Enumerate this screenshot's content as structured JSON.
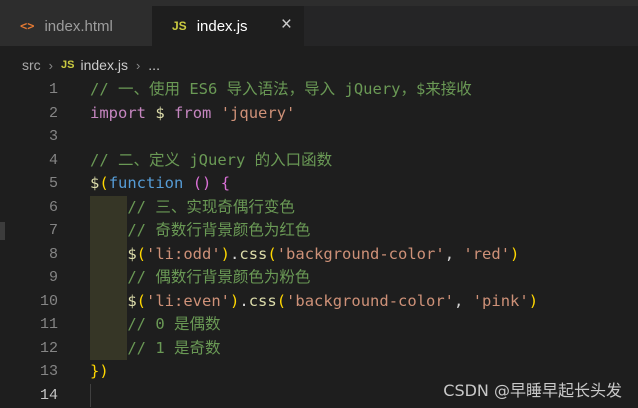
{
  "tabs": [
    {
      "icon": "<>",
      "label": "index.html"
    },
    {
      "icon": "JS",
      "label": "index.js",
      "close": "×"
    }
  ],
  "breadcrumb": {
    "folder": "src",
    "sep": "›",
    "file_icon": "JS",
    "file": "index.js",
    "more": "..."
  },
  "code_lines": [
    {
      "n": "1",
      "text": "// 一、使用 ES6 导入语法，导入 jQuery，$来接收"
    },
    {
      "n": "2",
      "text": "import $ from 'jquery'"
    },
    {
      "n": "3",
      "text": ""
    },
    {
      "n": "4",
      "text": "// 二、定义 jQuery 的入口函数"
    },
    {
      "n": "5",
      "text": "$(function () {"
    },
    {
      "n": "6",
      "text": "    // 三、实现奇偶行变色"
    },
    {
      "n": "7",
      "text": "    // 奇数行背景颜色为红色"
    },
    {
      "n": "8",
      "text": "    $('li:odd').css('background-color', 'red')"
    },
    {
      "n": "9",
      "text": "    // 偶数行背景颜色为粉色"
    },
    {
      "n": "10",
      "text": "    $('li:even').css('background-color', 'pink')"
    },
    {
      "n": "11",
      "text": "    // 0 是偶数"
    },
    {
      "n": "12",
      "text": "    // 1 是奇数"
    },
    {
      "n": "13",
      "text": "})"
    },
    {
      "n": "14",
      "text": ""
    }
  ],
  "watermark": "CSDN @早睡早起长头发"
}
